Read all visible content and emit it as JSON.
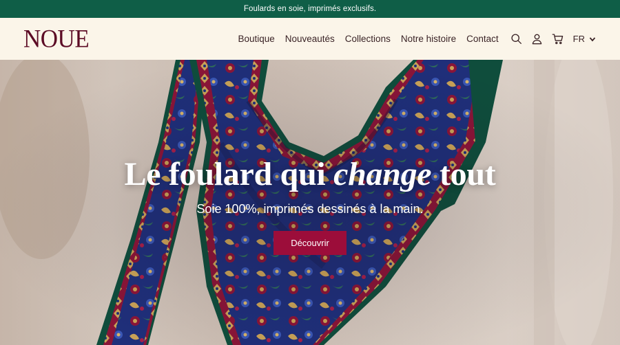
{
  "announcement": "Foulards en soie, imprimés exclusifs.",
  "brand": {
    "logo": "NOUE"
  },
  "nav": {
    "items": [
      {
        "label": "Boutique"
      },
      {
        "label": "Nouveautés"
      },
      {
        "label": "Collections"
      },
      {
        "label": "Notre histoire"
      },
      {
        "label": "Contact"
      }
    ],
    "icons": [
      "search-icon",
      "account-icon",
      "cart-icon"
    ],
    "language": "FR"
  },
  "hero": {
    "title_before": "Le foulard qui ",
    "title_emphasis": "change",
    "title_after": " tout",
    "subtitle": "Soie 100%, imprimés dessinés à la main.",
    "cta_label": "Découvrir"
  },
  "colors": {
    "announcement_bg": "#0f5e47",
    "header_bg": "#fbf5e9",
    "brand": "#5c0b25",
    "cta": "#9c0d3a",
    "scarf_navy": "#1f2f7a",
    "scarf_crimson": "#8a1538",
    "scarf_green": "#0f4d3c",
    "scarf_gold": "#c9a257"
  }
}
